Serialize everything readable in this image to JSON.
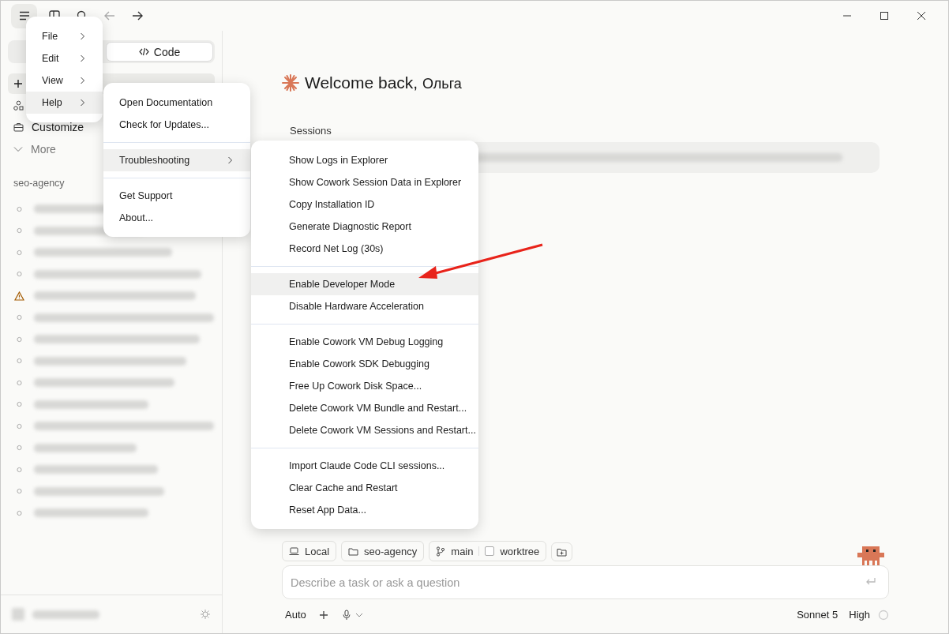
{
  "toolbar": {
    "back_disabled": true
  },
  "sidebar": {
    "mode_tabs": [
      {
        "label": "Code",
        "selected": true
      }
    ],
    "nav": [
      {
        "kind": "new",
        "selected": true
      },
      {
        "kind": "network",
        "selected": false
      },
      {
        "kind": "customize",
        "label": "Customize",
        "selected": false
      },
      {
        "kind": "more",
        "label": "More",
        "selected": false
      }
    ],
    "project": "seo-agency",
    "sessions": [
      {
        "kind": "session"
      },
      {
        "kind": "session"
      },
      {
        "kind": "session"
      },
      {
        "kind": "session"
      },
      {
        "kind": "warning"
      },
      {
        "kind": "session"
      },
      {
        "kind": "session"
      },
      {
        "kind": "session"
      },
      {
        "kind": "session"
      },
      {
        "kind": "session"
      },
      {
        "kind": "session"
      },
      {
        "kind": "session"
      },
      {
        "kind": "session"
      },
      {
        "kind": "session"
      },
      {
        "kind": "session"
      }
    ]
  },
  "main": {
    "greeting": "Welcome back,",
    "user_name": "Ольга",
    "sessions_heading": "Sessions",
    "chips": [
      {
        "kind": "laptop",
        "label": "Local"
      },
      {
        "kind": "folder",
        "label": "seo-agency"
      },
      {
        "kind": "branch",
        "label": "main"
      }
    ],
    "worktree": {
      "label": "worktree",
      "checked": false
    },
    "input": {
      "placeholder": "Describe a task or ask a question"
    },
    "footer": {
      "mode": "Auto",
      "model": "Sonnet 5",
      "effort": "High"
    }
  },
  "app_menu": [
    {
      "label": "File",
      "selected": false
    },
    {
      "label": "Edit",
      "selected": false
    },
    {
      "label": "View",
      "selected": false
    },
    {
      "label": "Help",
      "selected": true
    }
  ],
  "help_menu": [
    [
      {
        "label": "Open Documentation",
        "selected": false
      },
      {
        "label": "Check for Updates...",
        "selected": false
      }
    ],
    [
      {
        "label": "Troubleshooting",
        "selected": true,
        "submenu": true
      }
    ],
    [
      {
        "label": "Get Support",
        "selected": false
      },
      {
        "label": "About...",
        "selected": false
      }
    ]
  ],
  "troubleshooting_menu": [
    [
      {
        "label": "Show Logs in Explorer",
        "selected": false
      },
      {
        "label": "Show Cowork Session Data in Explorer",
        "selected": false
      },
      {
        "label": "Copy Installation ID",
        "selected": false
      },
      {
        "label": "Generate Diagnostic Report",
        "selected": false
      },
      {
        "label": "Record Net Log (30s)",
        "selected": false
      }
    ],
    [
      {
        "label": "Enable Developer Mode",
        "selected": true
      },
      {
        "label": "Disable Hardware Acceleration",
        "selected": false
      }
    ],
    [
      {
        "label": "Enable Cowork VM Debug Logging",
        "selected": false
      },
      {
        "label": "Enable Cowork SDK Debugging",
        "selected": false
      },
      {
        "label": "Free Up Cowork Disk Space...",
        "selected": false
      },
      {
        "label": "Delete Cowork VM Bundle and Restart...",
        "selected": false
      },
      {
        "label": "Delete Cowork VM Sessions and Restart...",
        "selected": false
      }
    ],
    [
      {
        "label": "Import Claude Code CLI sessions...",
        "selected": false
      },
      {
        "label": "Clear Cache and Restart",
        "selected": false
      },
      {
        "label": "Reset App Data...",
        "selected": false
      }
    ]
  ]
}
